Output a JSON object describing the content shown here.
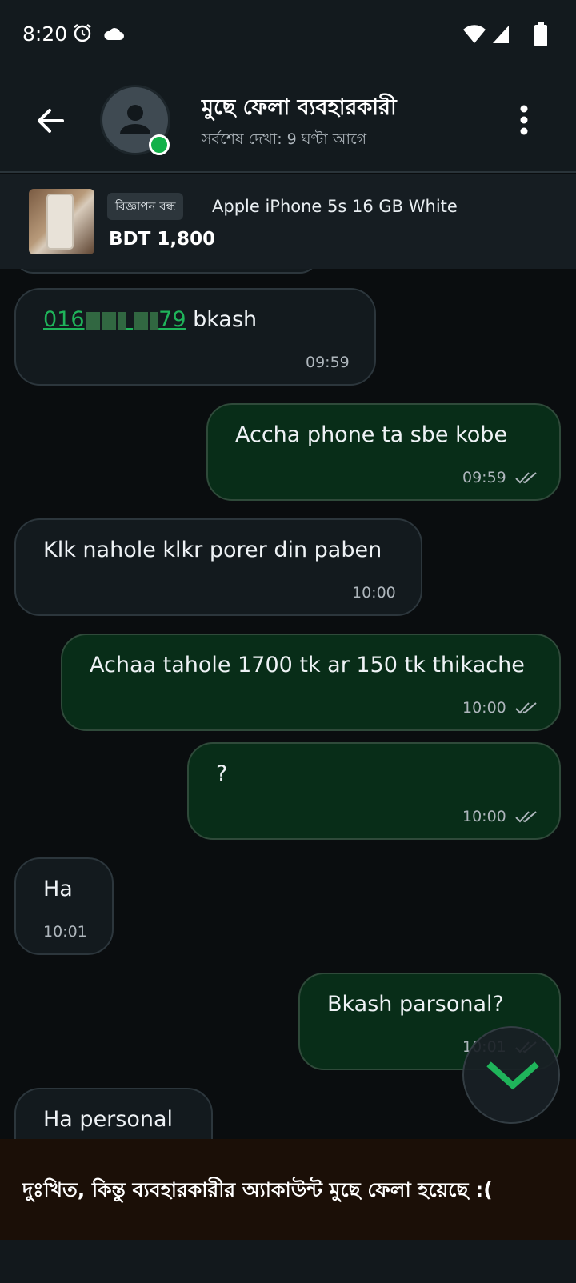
{
  "status_bar": {
    "time": "8:20",
    "icons": [
      "alarm-icon",
      "cloud-icon",
      "wifi-icon",
      "signal-icon",
      "battery-icon"
    ]
  },
  "header": {
    "name": "মুছে ফেলা ব্যবহারকারী",
    "last_seen": "সর্বশেষ দেখা: 9 ঘণ্টা আগে"
  },
  "ad": {
    "badge": "বিজ্ঞাপন বন্ধ",
    "title": "Apple iPhone 5s 16 GB White",
    "price": "BDT 1,800"
  },
  "messages": [
    {
      "dir": "in",
      "number_start": "016",
      "number_end": "79",
      "text": "bkash",
      "time": "09:59"
    },
    {
      "dir": "out",
      "text": "Accha phone ta sbe kobe",
      "time": "09:59"
    },
    {
      "dir": "in",
      "text": "Klk nahole klkr porer din paben",
      "time": "10:00"
    },
    {
      "dir": "out",
      "text": "Achaa tahole 1700 tk ar 150 tk thikache",
      "time": "10:00"
    },
    {
      "dir": "out",
      "text": "?",
      "time": "10:00"
    },
    {
      "dir": "in",
      "text": "Ha",
      "time": "10:01"
    },
    {
      "dir": "out",
      "text": "Bkash parsonal?",
      "time": "10:01"
    },
    {
      "dir": "in",
      "text": "Ha personal",
      "time": ""
    }
  ],
  "footer": {
    "deleted_notice": "দুঃখিত, কিন্তু ব্যবহারকারীর অ্যাকাউন্ট মুছে ফেলা হয়েছে :("
  },
  "colors": {
    "accent_green": "#1fb45a",
    "outgoing_bubble": "#082d18",
    "incoming_bubble": "#131a1e"
  }
}
